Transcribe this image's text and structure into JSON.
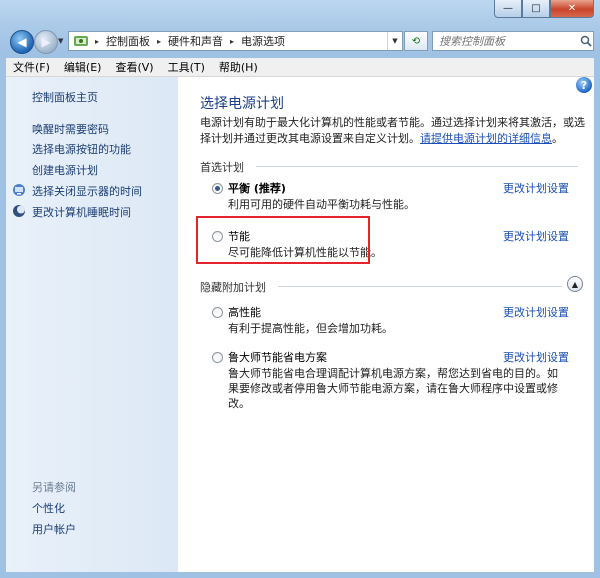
{
  "window": {
    "minimize": "—",
    "maximize": "□",
    "close": "✕"
  },
  "nav": {
    "address": [
      "控制面板",
      "硬件和声音",
      "电源选项"
    ],
    "search_placeholder": "搜索控制面板"
  },
  "menu": [
    "文件(F)",
    "编辑(E)",
    "查看(V)",
    "工具(T)",
    "帮助(H)"
  ],
  "sidebar": {
    "home": "控制面板主页",
    "links": [
      "唤醒时需要密码",
      "选择电源按钮的功能",
      "创建电源计划",
      "选择关闭显示器的时间",
      "更改计算机睡眠时间"
    ],
    "see_also": "另请参阅",
    "see_also_links": [
      "个性化",
      "用户帐户"
    ]
  },
  "main": {
    "title": "选择电源计划",
    "intro": "电源计划有助于最大化计算机的性能或者节能。通过选择计划来将其激活，或选择计划并通过更改其电源设置来自定义计划。",
    "intro_link": "请提供电源计划的详细信息",
    "intro_end": "。",
    "preferred_heading": "首选计划",
    "hidden_heading": "隐藏附加计划",
    "change_label": "更改计划设置",
    "plans": [
      {
        "name": "平衡 (推荐)",
        "desc": "利用可用的硬件自动平衡功耗与性能。",
        "selected": true
      },
      {
        "name": "节能",
        "desc": "尽可能降低计算机性能以节能。",
        "selected": false
      },
      {
        "name": "高性能",
        "desc": "有利于提高性能，但会增加功耗。",
        "selected": false
      },
      {
        "name": "鲁大师节能省电方案",
        "desc": "鲁大师节能省电合理调配计算机电源方案，帮您达到省电的目的。如果要修改或者停用鲁大师节能电源方案，请在鲁大师程序中设置或修改。",
        "selected": false
      }
    ]
  },
  "colors": {
    "link": "#1a4fb3",
    "title": "#1d3f8a",
    "highlight": "#e5232d"
  }
}
